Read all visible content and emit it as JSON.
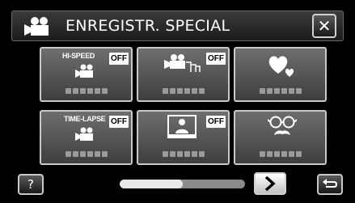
{
  "header": {
    "title": "ENREGISTR. SPECIAL",
    "mode_icon": "video-camera-icon",
    "close_label": "✕"
  },
  "tiles": [
    {
      "name": "HI-SPEED",
      "badge": "OFF",
      "icon": "camera-icon"
    },
    {
      "name": "",
      "badge": "OFF",
      "icon": "continuous-shooting-icon"
    },
    {
      "name": "",
      "badge": "",
      "icon": "hearts-icon"
    },
    {
      "name": "TIME-LAPSE",
      "badge": "OFF",
      "icon": "camera-icon"
    },
    {
      "name": "",
      "badge": "OFF",
      "icon": "portrait-icon"
    },
    {
      "name": "",
      "badge": "",
      "icon": "glasses-mustache-icon"
    }
  ],
  "footer": {
    "help_label": "?",
    "next_icon": "chevron-right-icon",
    "return_icon": "return-icon",
    "scroll_fraction": 0.5
  },
  "colors": {
    "background": "#000000",
    "tile_border": "#c8c8c8",
    "badge_bg": "#ffffff"
  }
}
